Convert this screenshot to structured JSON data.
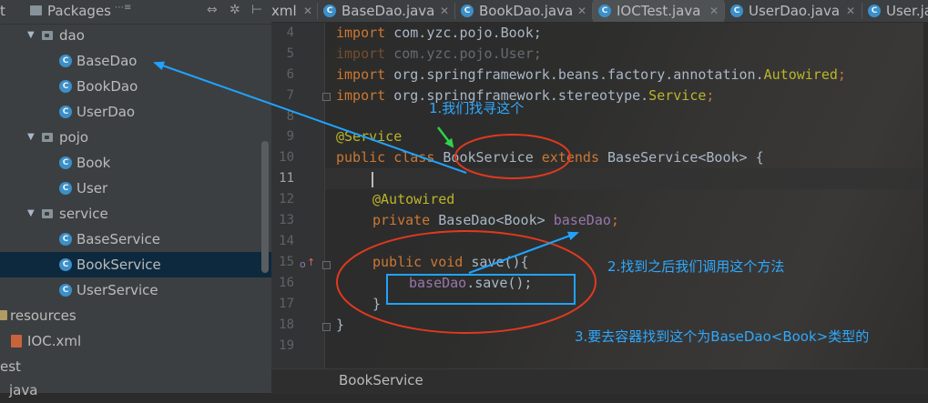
{
  "sidebar": {
    "header": {
      "t_text": "t",
      "title": "Packages",
      "badge": "⋯≡",
      "icons": [
        "⇔",
        "✲",
        "⊢"
      ]
    },
    "tree": [
      {
        "label": "dao",
        "type": "package",
        "expanded": true
      },
      {
        "label": "BaseDao",
        "type": "class"
      },
      {
        "label": "BookDao",
        "type": "class"
      },
      {
        "label": "UserDao",
        "type": "class"
      },
      {
        "label": "pojo",
        "type": "package",
        "expanded": true
      },
      {
        "label": "Book",
        "type": "class"
      },
      {
        "label": "User",
        "type": "class"
      },
      {
        "label": "service",
        "type": "package",
        "expanded": true
      },
      {
        "label": "BaseService",
        "type": "class"
      },
      {
        "label": "BookService",
        "type": "class",
        "selected": true
      },
      {
        "label": "UserService",
        "type": "class"
      },
      {
        "label": "resources",
        "type": "resource-folder"
      },
      {
        "label": "IOC.xml",
        "type": "xml"
      },
      {
        "label": "est",
        "type": "text"
      },
      {
        "label": "java",
        "type": "text"
      }
    ]
  },
  "tabs": [
    {
      "label": "xml",
      "icon": ""
    },
    {
      "label": "BaseDao.java",
      "icon": "C"
    },
    {
      "label": "BookDao.java",
      "icon": "C"
    },
    {
      "label": "IOCTest.java",
      "icon": "C",
      "active": true
    },
    {
      "label": "UserDao.java",
      "icon": "C"
    },
    {
      "label": "User.ja",
      "icon": "C"
    }
  ],
  "editor": {
    "line_numbers": [
      "4",
      "5",
      "6",
      "7",
      "8",
      "9",
      "10",
      "11",
      "12",
      "13",
      "14",
      "15",
      "16",
      "17",
      "18",
      "19"
    ],
    "current_line": "11",
    "lines": {
      "l4": {
        "kw": "import",
        "rest": " com.yzc.pojo.Book;"
      },
      "l5": {
        "kw": "import",
        "rest": " com.yzc.pojo.User;"
      },
      "l6": {
        "kw": "import",
        "rest": " org.springframework.beans.factory.annotation.",
        "tail": "Autowired",
        "end": ";"
      },
      "l7": {
        "kw": "import",
        "rest": " org.springframework.stereotype.",
        "tail": "Service",
        "end": ";"
      },
      "l9": {
        "ann": "@Service"
      },
      "l10": {
        "kw1": "public",
        "kw2": " class ",
        "name": "BookService",
        "kw3": " extends ",
        "rest": "BaseService<Book> {"
      },
      "l12": {
        "ann": "@Autowired"
      },
      "l13": {
        "kw": "private",
        "type": " BaseDao<Book> ",
        "field": "baseDao",
        "end": ";"
      },
      "l15": {
        "kw": "public void",
        "rest": " save(){"
      },
      "l16": {
        "field": "baseDao",
        "rest": ".save();"
      },
      "l17": {
        "text": "}"
      },
      "l18": {
        "text": "}"
      }
    },
    "breadcrumb": "BookService"
  },
  "annotations": {
    "note1": "1.我们找寻这个",
    "note2": "2.找到之后我们调用这个方法",
    "note3": "3.要去容器找到这个为BaseDao<Book>类型的",
    "colors": {
      "arrow": "#1fa3ff",
      "highlight_ellipse": "#e0391f",
      "green_arrow": "#2fd34a",
      "box": "#1fa3ff"
    }
  }
}
